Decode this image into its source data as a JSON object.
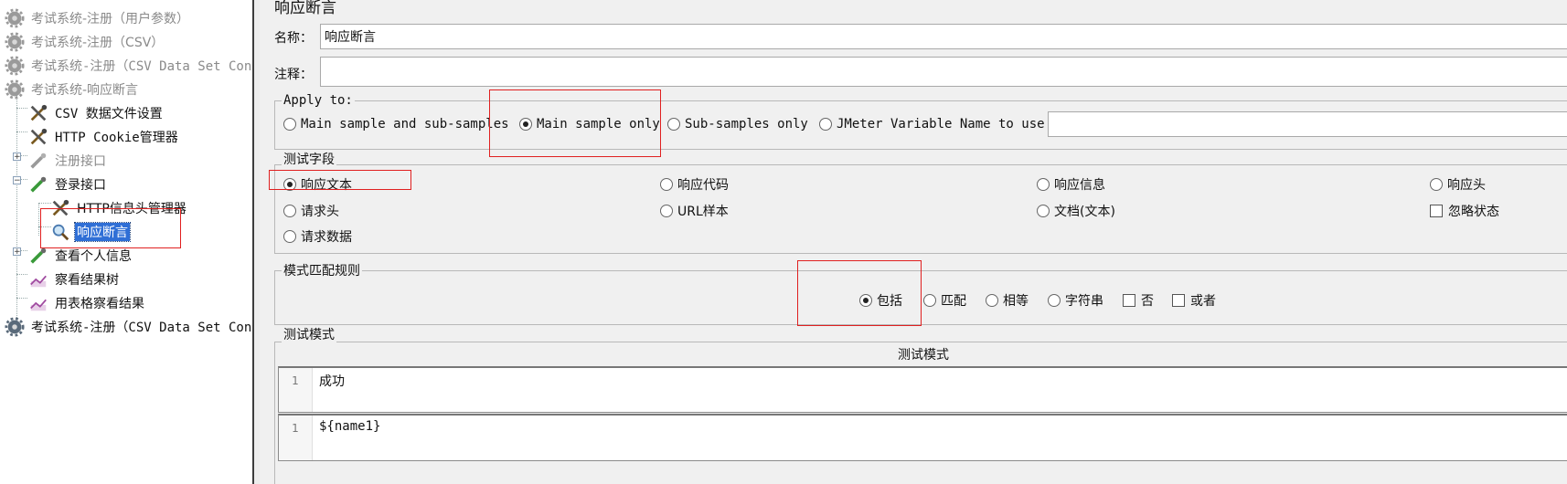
{
  "tree": {
    "items": [
      {
        "label": "考试系统-注册（用户参数）",
        "icon": "gear-icon",
        "gray": true
      },
      {
        "label": "考试系统-注册（CSV）",
        "icon": "gear-icon",
        "gray": true
      },
      {
        "label": "考试系统-注册（CSV Data Set Con",
        "icon": "gear-icon",
        "gray": true
      },
      {
        "label": "考试系统-响应断言",
        "icon": "gear-icon",
        "gray": true
      },
      {
        "label": "CSV 数据文件设置",
        "icon": "wrench-icon",
        "gray": false
      },
      {
        "label": "HTTP Cookie管理器",
        "icon": "wrench-icon",
        "gray": false
      },
      {
        "label": "注册接口",
        "icon": "pipette-icon",
        "gray": true
      },
      {
        "label": "登录接口",
        "icon": "pipette-icon",
        "gray": false
      },
      {
        "label": "HTTP信息头管理器",
        "icon": "wrench-icon",
        "gray": false
      },
      {
        "label": "响应断言",
        "icon": "magnifier-icon",
        "gray": false
      },
      {
        "label": "查看个人信息",
        "icon": "pipette-icon",
        "gray": false
      },
      {
        "label": "察看结果树",
        "icon": "graph-icon",
        "gray": false
      },
      {
        "label": "用表格察看结果",
        "icon": "graph-icon",
        "gray": false
      },
      {
        "label": "考试系统-注册（CSV Data Set Con",
        "icon": "gear-icon",
        "gray": false
      }
    ]
  },
  "panel": {
    "title": "响应断言",
    "name_label": "名称：",
    "name_value": "响应断言",
    "comment_label": "注释：",
    "comment_value": "",
    "apply_to": {
      "title": "Apply to:",
      "options": [
        "Main sample and sub-samples",
        "Main sample only",
        "Sub-samples only",
        "JMeter Variable Name to use"
      ],
      "selected": "Main sample only",
      "variable_value": ""
    },
    "test_field": {
      "title": "测试字段",
      "options": [
        "响应文本",
        "响应代码",
        "响应信息",
        "响应头",
        "请求头",
        "URL样本",
        "文档(文本)",
        "请求数据"
      ],
      "selected": "响应文本",
      "ignore_status_label": "忽略状态",
      "ignore_status_checked": false
    },
    "pattern_rules": {
      "title": "模式匹配规则",
      "options": [
        "包括",
        "匹配",
        "相等",
        "字符串"
      ],
      "selected": "包括",
      "not_label": "否",
      "not_checked": false,
      "or_label": "或者",
      "or_checked": false
    },
    "test_patterns": {
      "title": "测试模式",
      "column_header": "测试模式",
      "rows": [
        {
          "line": "1",
          "text": "成功"
        },
        {
          "line": "1",
          "text": "${name1}"
        }
      ]
    }
  }
}
